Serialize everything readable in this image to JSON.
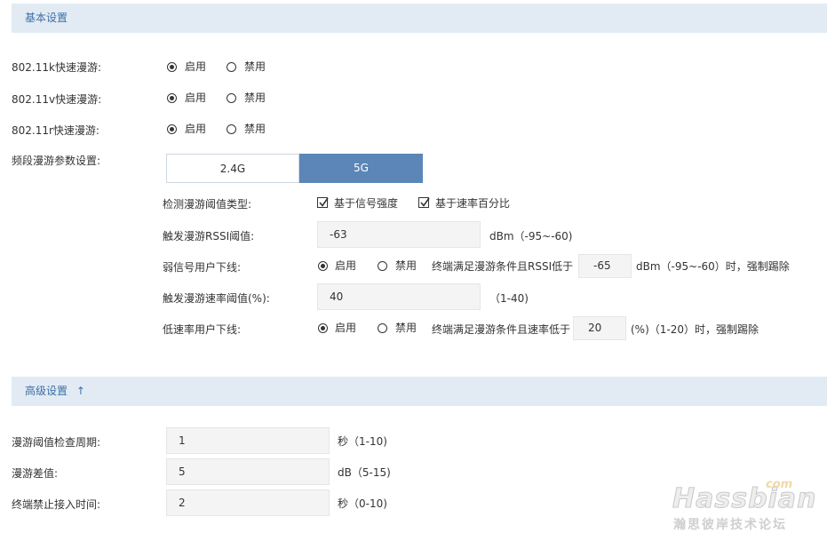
{
  "basic": {
    "title": "基本设置",
    "k_label": "802.11k快速漫游:",
    "v_label": "802.11v快速漫游:",
    "r_label": "802.11r快速漫游:",
    "enable": "启用",
    "disable": "禁用",
    "band_label": "频段漫游参数设置:",
    "band_tabs": [
      "2.4G",
      "5G"
    ],
    "selected_band": "5G"
  },
  "band": {
    "threshold_type_label": "检测漫游阈值类型:",
    "signal_strength": "基于信号强度",
    "rate_percent": "基于速率百分比",
    "rssi_label": "触发漫游RSSI阈值:",
    "rssi_value": "-63",
    "rssi_unit": "dBm（-95~-60)",
    "weak_label": "弱信号用户下线:",
    "weak_desc": "终端满足漫游条件且RSSI低于",
    "weak_value": "-65",
    "weak_unit": "dBm（-95~-60）时，强制踢除",
    "rate_label": "触发漫游速率阈值(%):",
    "rate_value": "40",
    "rate_unit": "（1-40)",
    "low_label": "低速率用户下线:",
    "low_desc": "终端满足漫游条件且速率低于",
    "low_value": "20",
    "low_unit": "(%)（1-20）时，强制踢除"
  },
  "advanced": {
    "title": "高级设置",
    "arrow": "↑",
    "period_label": "漫游阈值检查周期:",
    "period_value": "1",
    "period_unit": "秒（1-10)",
    "diff_label": "漫游差值:",
    "diff_value": "5",
    "diff_unit": "dB（5-15)",
    "ban_label": "终端禁止接入时间:",
    "ban_value": "2",
    "ban_unit": "秒（0-10)"
  },
  "watermark": {
    "brand": "Hassbian",
    "tld": "com",
    "forum": "瀚思彼岸技术论坛"
  }
}
